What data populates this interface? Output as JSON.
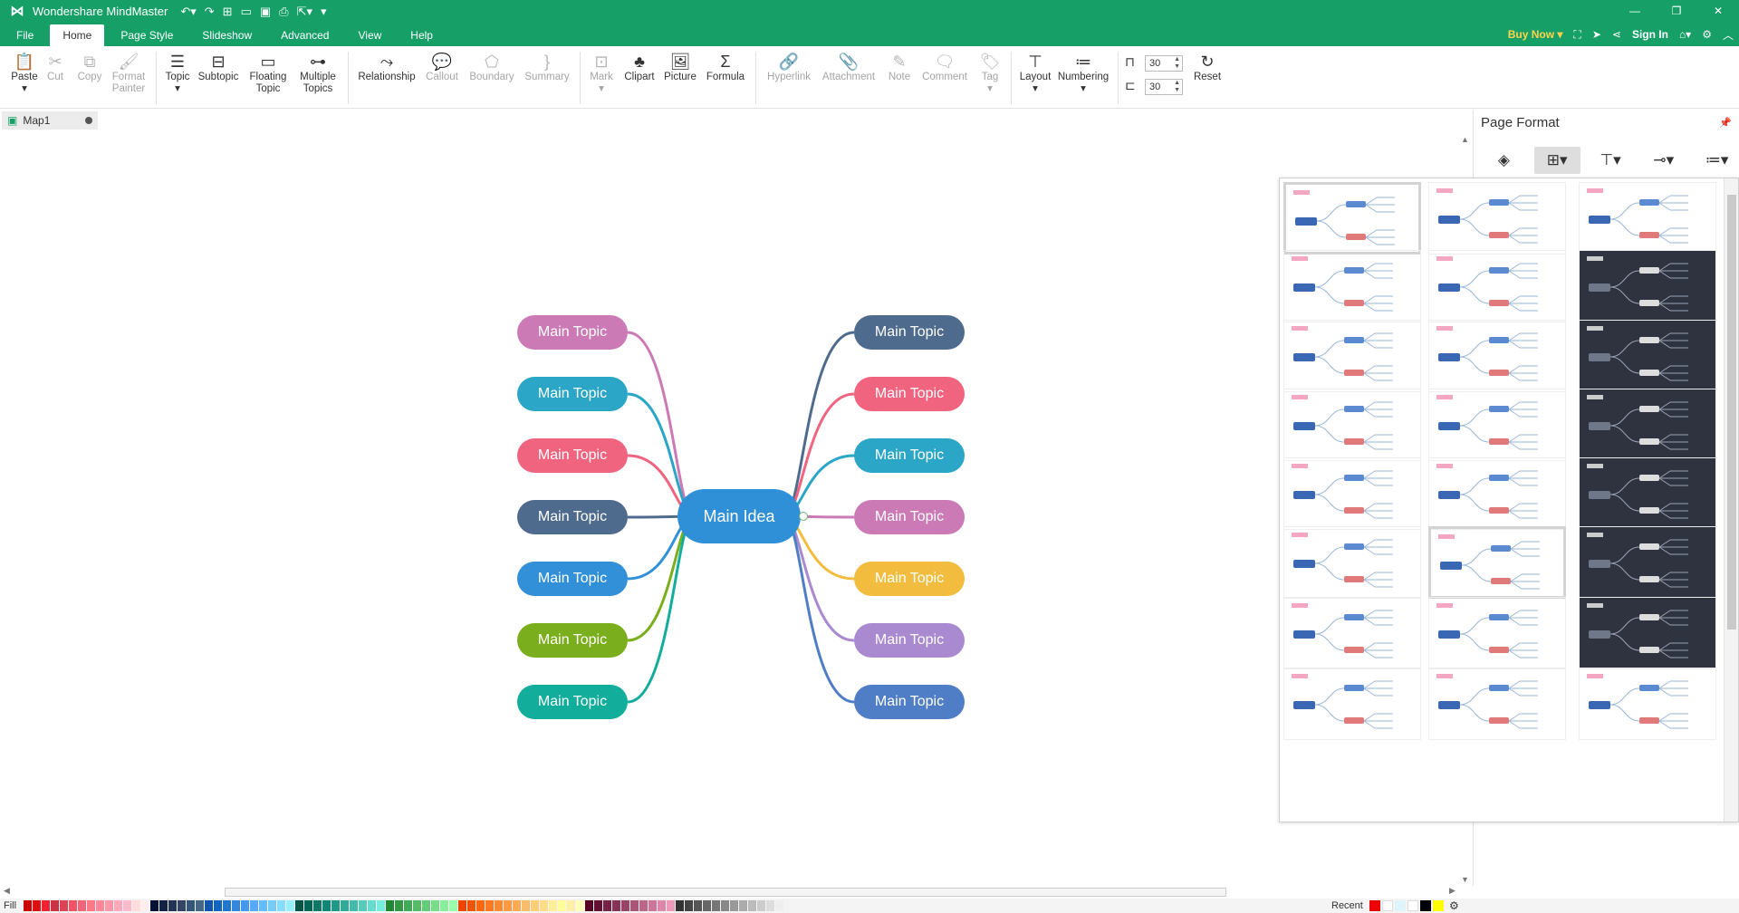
{
  "app": {
    "title": "Wondershare MindMaster"
  },
  "menu": {
    "tabs": [
      "File",
      "Home",
      "Page Style",
      "Slideshow",
      "Advanced",
      "View",
      "Help"
    ],
    "active": "Home",
    "buy_now": "Buy Now",
    "sign_in": "Sign In"
  },
  "ribbon": {
    "paste": "Paste",
    "cut": "Cut",
    "copy": "Copy",
    "format_painter_1": "Format",
    "format_painter_2": "Painter",
    "topic": "Topic",
    "subtopic": "Subtopic",
    "floating_topic_1": "Floating",
    "floating_topic_2": "Topic",
    "multiple_topics_1": "Multiple",
    "multiple_topics_2": "Topics",
    "relationship": "Relationship",
    "callout": "Callout",
    "boundary": "Boundary",
    "summary": "Summary",
    "mark": "Mark",
    "clipart": "Clipart",
    "picture": "Picture",
    "formula": "Formula",
    "hyperlink": "Hyperlink",
    "attachment": "Attachment",
    "note": "Note",
    "comment": "Comment",
    "tag": "Tag",
    "layout": "Layout",
    "numbering": "Numbering",
    "spacing_h": "30",
    "spacing_v": "30",
    "reset": "Reset"
  },
  "document": {
    "tab_name": "Map1"
  },
  "mindmap": {
    "central": "Main Idea",
    "left": [
      {
        "label": "Main Topic",
        "color": "#cc7ab5"
      },
      {
        "label": "Main Topic",
        "color": "#2ba6c7"
      },
      {
        "label": "Main Topic",
        "color": "#f06480"
      },
      {
        "label": "Main Topic",
        "color": "#4e6b8e"
      },
      {
        "label": "Main Topic",
        "color": "#3190d8"
      },
      {
        "label": "Main Topic",
        "color": "#7aae1c"
      },
      {
        "label": "Main Topic",
        "color": "#13ad9b"
      }
    ],
    "right": [
      {
        "label": "Main Topic",
        "color": "#4e6b8e"
      },
      {
        "label": "Main Topic",
        "color": "#f06480"
      },
      {
        "label": "Main Topic",
        "color": "#2ba6c7"
      },
      {
        "label": "Main Topic",
        "color": "#cc7ab5"
      },
      {
        "label": "Main Topic",
        "color": "#f2bd3f"
      },
      {
        "label": "Main Topic",
        "color": "#a98ad0"
      },
      {
        "label": "Main Topic",
        "color": "#4f7ec7"
      }
    ]
  },
  "panel": {
    "title": "Page Format"
  },
  "fillbar": {
    "label": "Fill",
    "recent": "Recent"
  }
}
